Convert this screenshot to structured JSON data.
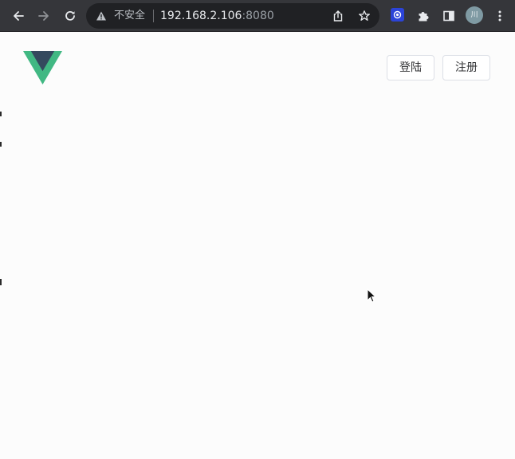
{
  "browser": {
    "address_bar": {
      "security_label": "不安全",
      "url_host": "192.168.2.106",
      "url_port": ":8080"
    },
    "profile": {
      "avatar_text": "川"
    },
    "icons": [
      "back-icon",
      "forward-icon",
      "reload-icon",
      "warning-icon",
      "share-icon",
      "star-icon",
      "extension-app-icon",
      "puzzle-icon",
      "side-panel-icon",
      "more-vert-icon"
    ]
  },
  "header": {
    "logo": "vue-logo",
    "login_label": "登陆",
    "register_label": "注册"
  },
  "colors": {
    "vue_green": "#41b883",
    "vue_dark": "#34495e",
    "toolbar_bg": "#35363a",
    "omnibox_bg": "#202124",
    "page_bg": "#fcfcfc"
  }
}
